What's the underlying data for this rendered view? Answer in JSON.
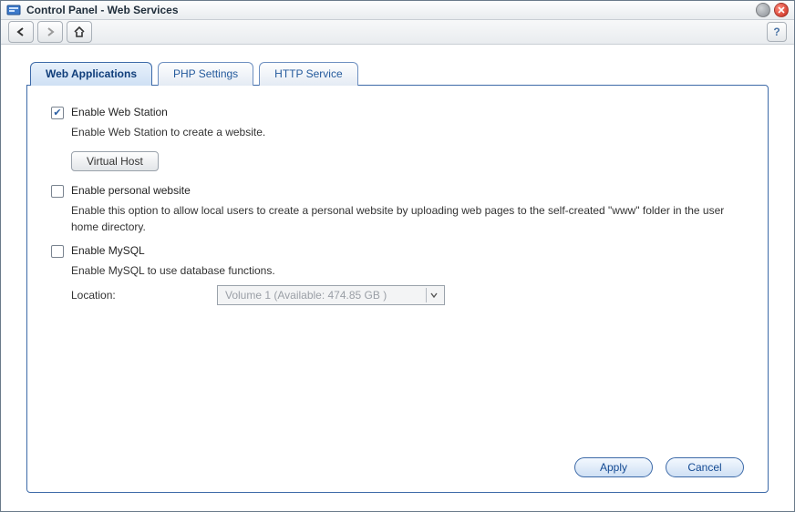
{
  "window": {
    "title": "Control Panel - Web Services"
  },
  "toolbar": {
    "help_label": "?"
  },
  "tabs": [
    {
      "label": "Web Applications",
      "active": true
    },
    {
      "label": "PHP Settings",
      "active": false
    },
    {
      "label": "HTTP Service",
      "active": false
    }
  ],
  "options": {
    "web_station": {
      "label": "Enable Web Station",
      "checked": true,
      "desc": "Enable Web Station to create a website.",
      "virtual_host_btn": "Virtual Host"
    },
    "personal_website": {
      "label": "Enable personal website",
      "checked": false,
      "desc": "Enable this option to allow local users to create a personal website by uploading web pages to the self-created \"www\" folder in the user home directory."
    },
    "mysql": {
      "label": "Enable MySQL",
      "checked": false,
      "desc": "Enable MySQL to use database functions.",
      "location_label": "Location:",
      "location_value": "Volume 1 (Available: 474.85 GB )"
    }
  },
  "footer": {
    "apply": "Apply",
    "cancel": "Cancel"
  }
}
